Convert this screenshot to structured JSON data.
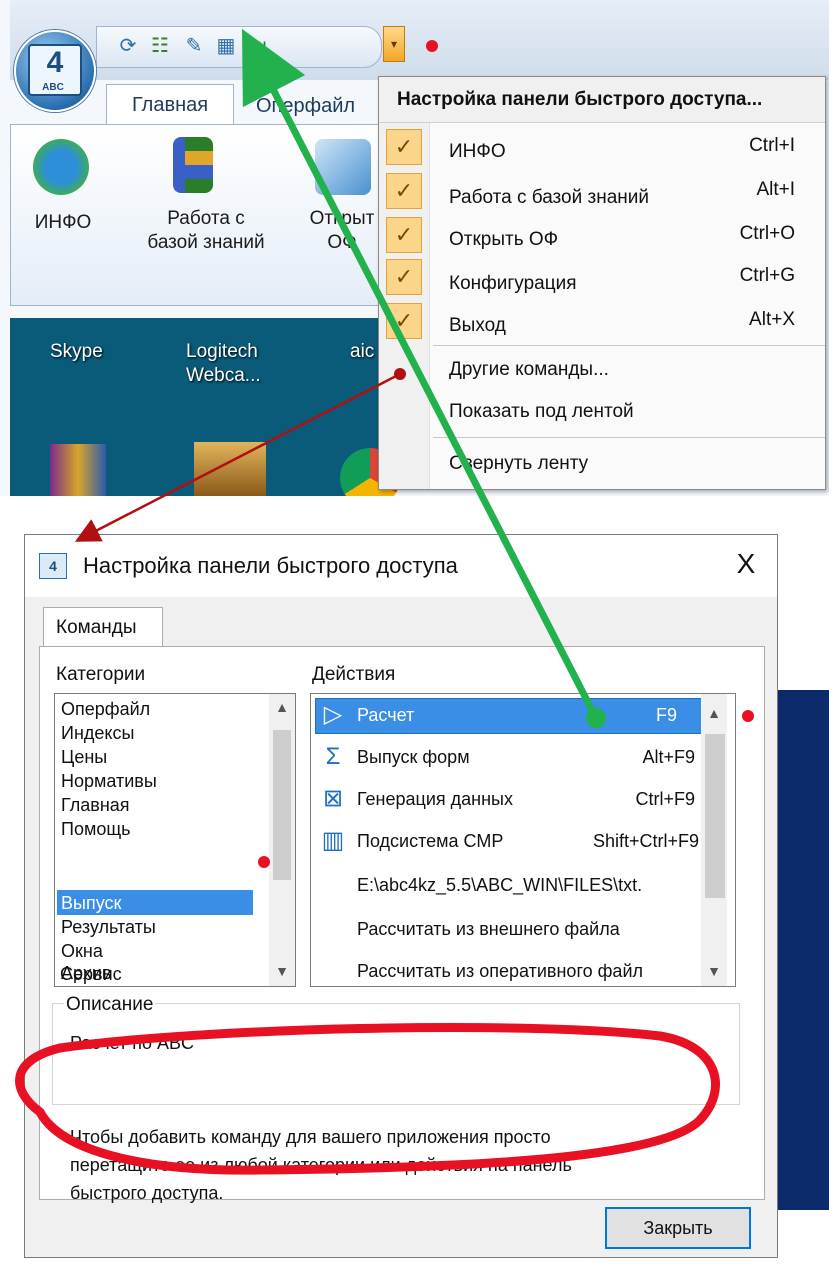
{
  "ribbon": {
    "tabs": [
      "Главная",
      "Операфайл"
    ],
    "tab_main": "Главная",
    "tab_operfile": "Оперфайл",
    "logo_sub": "ABC",
    "logo_mark": "4",
    "buttons": [
      {
        "label": "ИНФО"
      },
      {
        "label": "Работа с базой знаний"
      },
      {
        "label": "Открыть ОФ"
      }
    ],
    "btn_info": "ИНФО",
    "btn_kb_line1": "Работа с",
    "btn_kb_line2": "базой знаний",
    "btn_open_line1": "Открыт",
    "btn_open_line2": "ОФ"
  },
  "desktop": {
    "skype": "Skype",
    "logitech_line1": "Logitech",
    "logitech_line2": "Webca...",
    "aic": "aic"
  },
  "menu": {
    "title": "Настройка панели быстрого доступа...",
    "items": [
      {
        "label": "ИНФО",
        "shortcut": "Ctrl+I",
        "checked": true
      },
      {
        "label": "Работа с базой знаний",
        "shortcut": "Alt+I",
        "checked": true
      },
      {
        "label": "Открыть ОФ",
        "shortcut": "Ctrl+O",
        "checked": true
      },
      {
        "label": "Конфигурация",
        "shortcut": "Ctrl+G",
        "checked": true
      },
      {
        "label": "Выход",
        "shortcut": "Alt+X",
        "checked": true
      }
    ],
    "other_commands": "Другие команды...",
    "show_below": "Показать под лентой",
    "minimize": "Свернуть ленту",
    "check_glyph": "✓"
  },
  "dialog": {
    "title": "Настройка панели быстрого доступа",
    "close_glyph": "X",
    "tab": "Команды",
    "categories_label": "Категории",
    "actions_label": "Действия",
    "categories": [
      "Оперфайл",
      "Индексы",
      "Цены",
      "Нормативы",
      "Главная",
      "Помощь",
      "Выпуск",
      "Результаты",
      "Окна",
      "Архив",
      "Сервис"
    ],
    "selected_category": "Выпуск",
    "actions": [
      {
        "label": "Расчет",
        "shortcut": "F9",
        "icon": "play-icon"
      },
      {
        "label": "Выпуск форм",
        "shortcut": "Alt+F9",
        "icon": "sigma-icon"
      },
      {
        "label": "Генерация данных",
        "shortcut": "Ctrl+F9",
        "icon": "generate-icon"
      },
      {
        "label": "Подсистема СМР",
        "shortcut": "Shift+Ctrl+F9",
        "icon": "chart-icon"
      },
      {
        "label": "E:\\abc4kz_5.5\\ABC_WIN\\FILES\\txt.",
        "shortcut": "",
        "icon": ""
      },
      {
        "label": "Рассчитать из внешнего файла",
        "shortcut": "",
        "icon": ""
      },
      {
        "label": "Рассчитать из оперативного файл",
        "shortcut": "",
        "icon": ""
      }
    ],
    "description_label": "Описание",
    "description": "Расчет по ABC",
    "hint_line1": "Чтобы добавить команду для вашего приложения просто",
    "hint_line2": "перетащите ее из любой категории или действия на панель",
    "hint_line3": "быстрого доступа.",
    "close_button": "Закрыть"
  },
  "colors": {
    "accent": "#3a8ee6",
    "menu_check": "#fbd68a",
    "annotation_green": "#22b14c",
    "annotation_red": "#e81123",
    "arrow_darkred": "#b01010"
  }
}
